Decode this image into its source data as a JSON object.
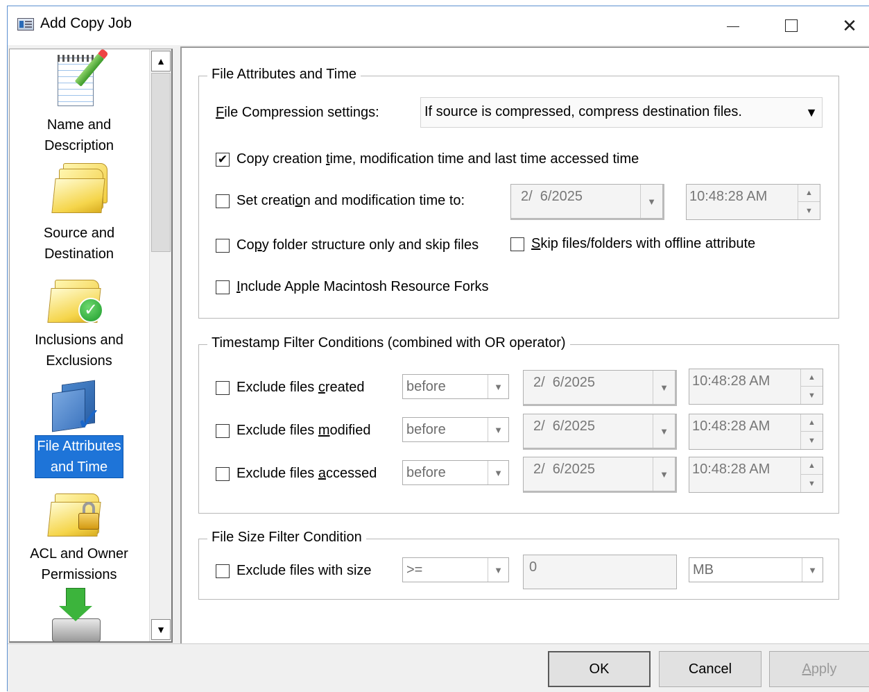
{
  "window": {
    "title": "Add Copy Job",
    "controls": {
      "minimize_icon": "minimize-icon",
      "maximize_icon": "maximize-icon",
      "close_icon": "close-icon"
    }
  },
  "nav": {
    "items": [
      {
        "label_line1": "Name and",
        "label_line2": "Description",
        "icon": "notebook-pencil-icon",
        "selected": false
      },
      {
        "label_line1": "Source and",
        "label_line2": "Destination",
        "icon": "folders-icon",
        "selected": false
      },
      {
        "label_line1": "Inclusions and",
        "label_line2": "Exclusions",
        "icon": "folder-check-icon",
        "selected": false
      },
      {
        "label_line1": "File Attributes",
        "label_line2": "and Time",
        "icon": "documents-check-icon",
        "selected": true
      },
      {
        "label_line1": "ACL and Owner",
        "label_line2": "Permissions",
        "icon": "folder-lock-icon",
        "selected": false
      },
      {
        "label_line1": "",
        "label_line2": "",
        "icon": "download-drive-icon",
        "selected": false
      }
    ],
    "selected_color": "#1e74d8"
  },
  "attributes_group": {
    "title": "File Attributes and Time",
    "compression_label_prefix": "",
    "compression_label_u": "F",
    "compression_label_rest": "ile Compression settings:",
    "compression_value": "If source is compressed, compress destination files.",
    "copy_times": {
      "prefix": "Copy creation ",
      "u": "t",
      "rest": "ime, modification time and last time accessed time",
      "checked": true
    },
    "set_times": {
      "prefix": "Set creati",
      "u": "o",
      "rest": "n and modification time to:",
      "checked": false,
      "date": "2/  6/2025",
      "time": "10:48:28 AM"
    },
    "folder_only": {
      "prefix": "Co",
      "u": "p",
      "rest": "y folder structure only and skip files",
      "checked": false
    },
    "skip_offline": {
      "prefix": "",
      "u": "S",
      "rest": "kip files/folders with offline attribute",
      "checked": false
    },
    "apple_forks": {
      "prefix": "",
      "u": "I",
      "rest": "nclude Apple Macintosh Resource Forks",
      "checked": false
    }
  },
  "timestamp_group": {
    "title": "Timestamp Filter Conditions (combined with OR operator)",
    "rows": [
      {
        "prefix": "Exclude files ",
        "u": "c",
        "rest": "reated",
        "operator": "before",
        "date": "2/  6/2025",
        "time": "10:48:28 AM",
        "checked": false
      },
      {
        "prefix": "Exclude files ",
        "u": "m",
        "rest": "odified",
        "operator": "before",
        "date": "2/  6/2025",
        "time": "10:48:28 AM",
        "checked": false
      },
      {
        "prefix": "Exclude files ",
        "u": "a",
        "rest": "ccessed",
        "operator": "before",
        "date": "2/  6/2025",
        "time": "10:48:28 AM",
        "checked": false
      }
    ]
  },
  "size_group": {
    "title": "File Size Filter Condition",
    "label": "Exclude files with size",
    "checked": false,
    "operator": ">=",
    "value": "0",
    "unit": "MB"
  },
  "buttons": {
    "ok": "OK",
    "cancel": "Cancel",
    "apply_u": "A",
    "apply_rest": "pply"
  }
}
